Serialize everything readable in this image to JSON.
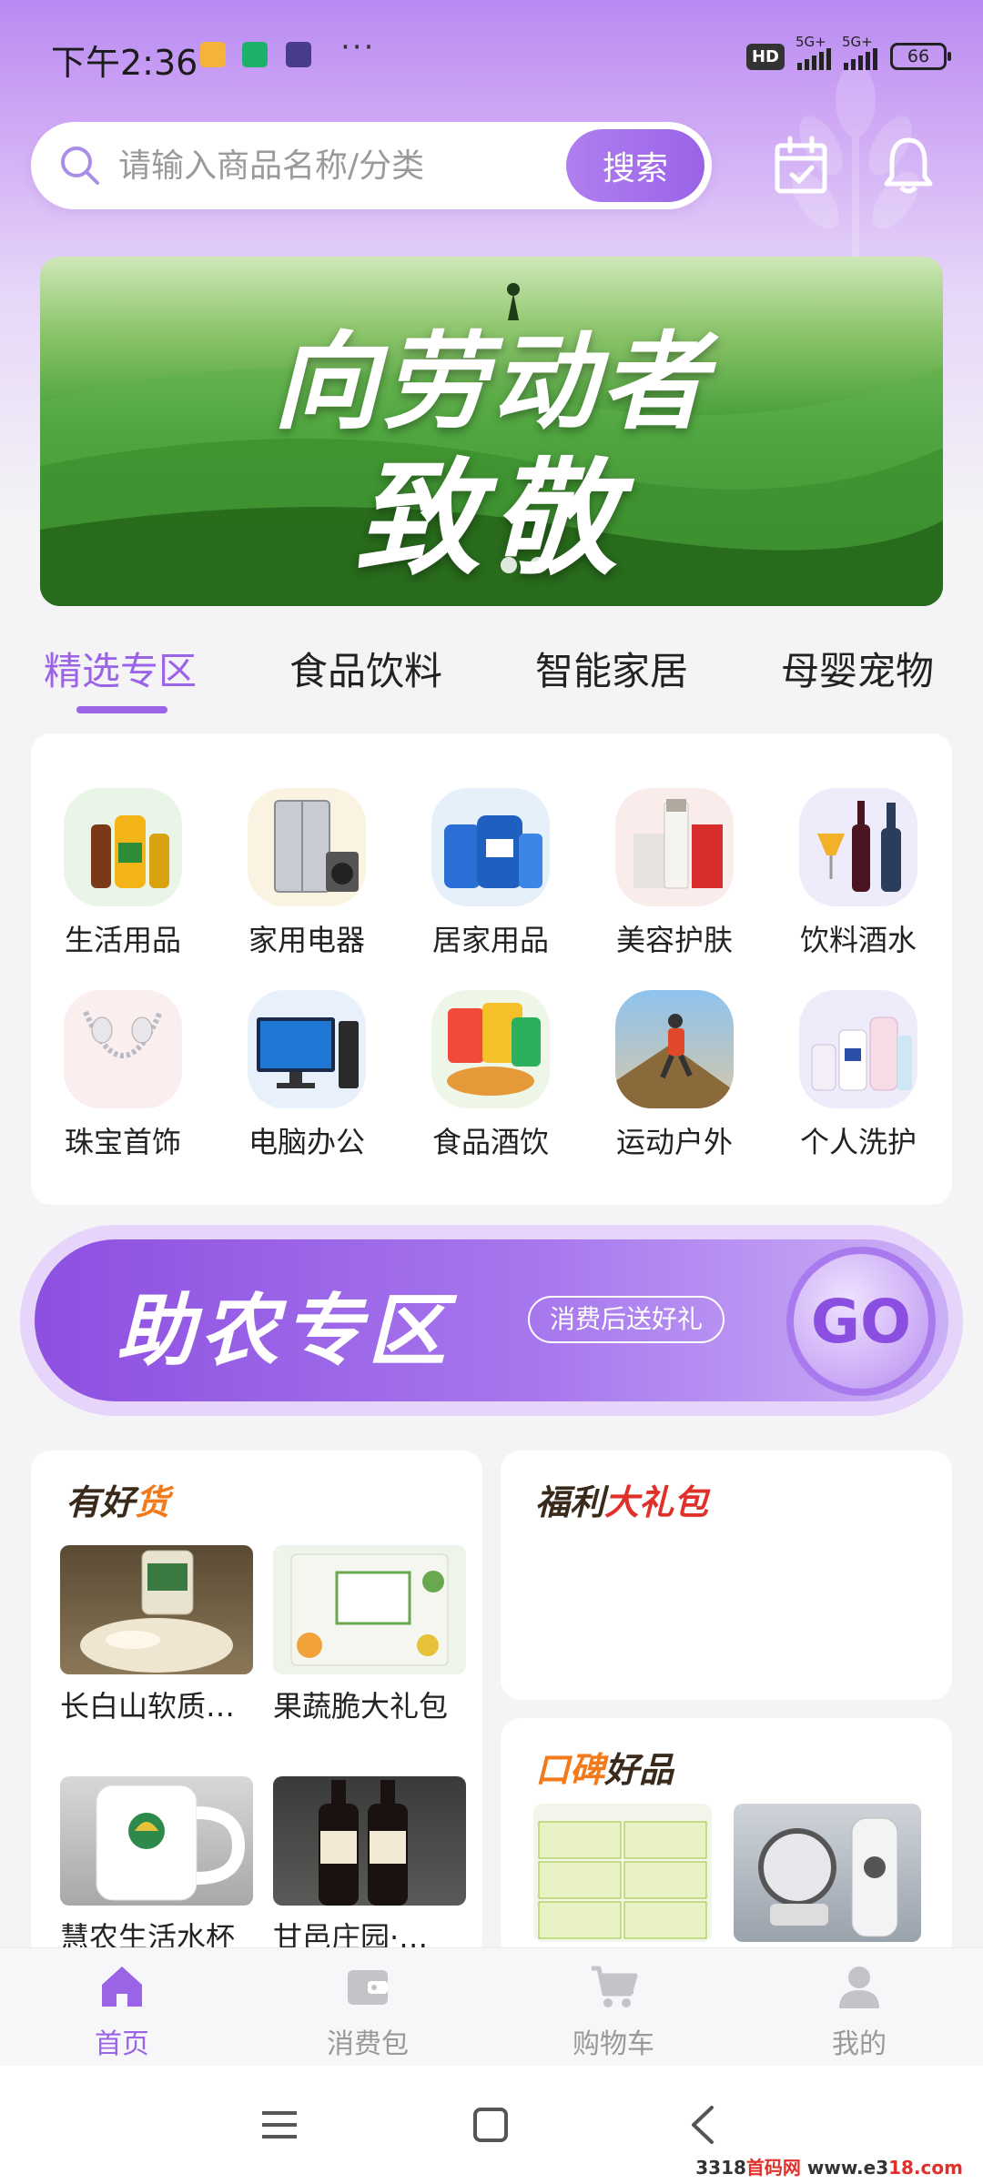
{
  "status_bar": {
    "time": "下午2:36",
    "more": "···",
    "hd": "HD",
    "net1": "5G+",
    "net2": "5G+",
    "battery": "66"
  },
  "search": {
    "placeholder": "请输入商品名称/分类",
    "button": "搜索"
  },
  "banner": {
    "line1": "向劳动者",
    "line2": "致敬"
  },
  "category_tabs": [
    {
      "label": "精选专区",
      "active": true
    },
    {
      "label": "食品饮料",
      "active": false
    },
    {
      "label": "智能家居",
      "active": false
    },
    {
      "label": "母婴宠物",
      "active": false
    }
  ],
  "categories": [
    {
      "label": "生活用品",
      "icon": "cooking-oil-icon"
    },
    {
      "label": "家用电器",
      "icon": "appliance-icon"
    },
    {
      "label": "居家用品",
      "icon": "detergent-icon"
    },
    {
      "label": "美容护肤",
      "icon": "skincare-icon"
    },
    {
      "label": "饮料酒水",
      "icon": "liquor-icon"
    },
    {
      "label": "珠宝首饰",
      "icon": "necklace-icon"
    },
    {
      "label": "电脑办公",
      "icon": "computer-icon"
    },
    {
      "label": "食品酒饮",
      "icon": "snacks-icon"
    },
    {
      "label": "运动户外",
      "icon": "hiking-icon"
    },
    {
      "label": "个人洗护",
      "icon": "bodycare-icon"
    }
  ],
  "farm_banner": {
    "title": "助农专区",
    "tag": "消费后送好礼",
    "go": "GO"
  },
  "good_stuff": {
    "title_a": "有好",
    "title_b": "货",
    "products": [
      {
        "name": "长白山软质…"
      },
      {
        "name": "果蔬脆大礼包"
      },
      {
        "name": "慧农生活水杯"
      },
      {
        "name": "甘邑庄园·…"
      }
    ]
  },
  "welfare": {
    "title_a": "福利",
    "title_b": "大礼包"
  },
  "reputation": {
    "title_a": "口碑",
    "title_b": "好品"
  },
  "bottom_nav": [
    {
      "label": "首页",
      "active": true
    },
    {
      "label": "消费包",
      "active": false
    },
    {
      "label": "购物车",
      "active": false
    },
    {
      "label": "我的",
      "active": false
    }
  ],
  "watermark": {
    "a": "3318",
    "b": "首码网",
    "c": "www.e3",
    "d": "18.com"
  },
  "colors": {
    "accent": "#9b63e6",
    "hero_top": "#b98af2",
    "banner_green": "#2c7d22"
  }
}
